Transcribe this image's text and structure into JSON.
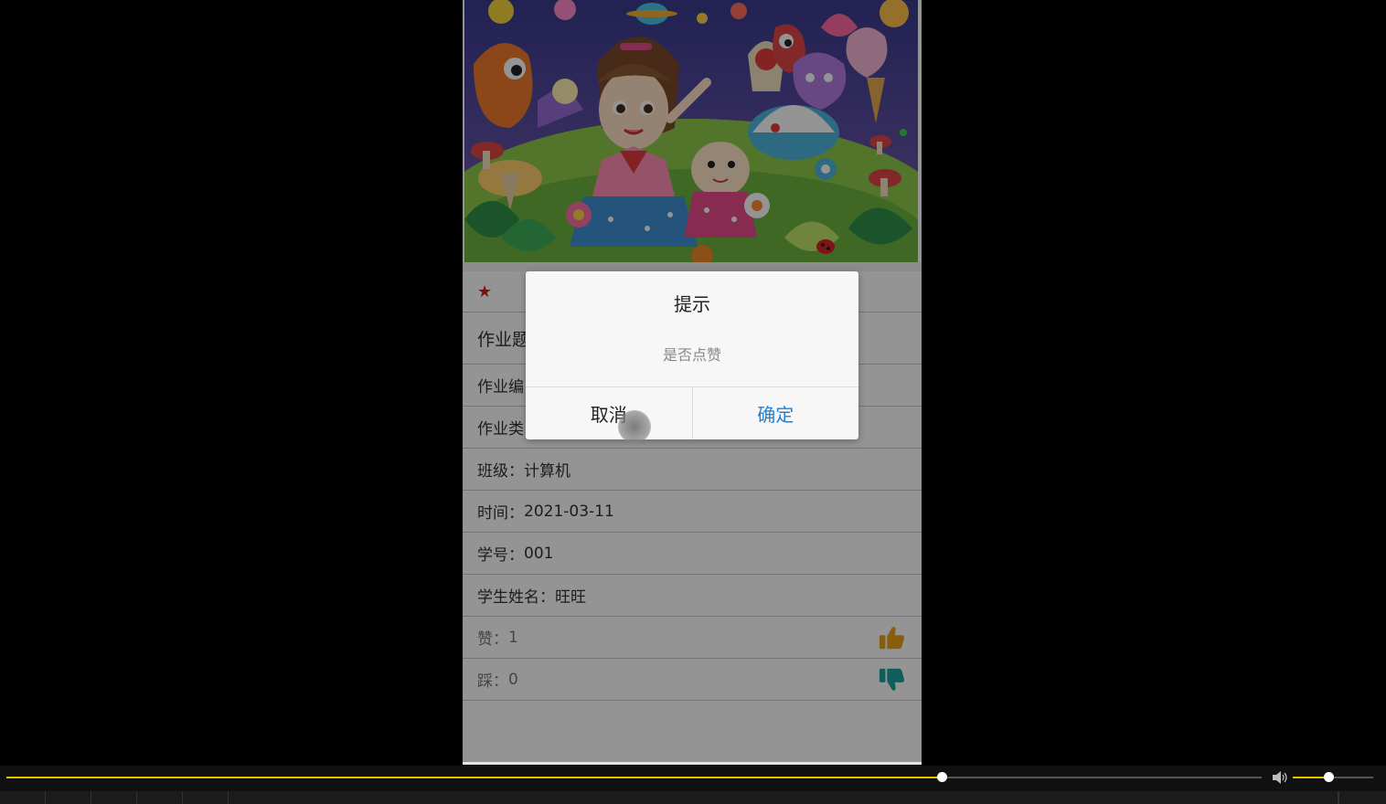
{
  "detail": {
    "title_label": "作业题",
    "code_label": "作业编",
    "type_label": "作业类",
    "class": {
      "label": "班级：",
      "value": "计算机"
    },
    "time": {
      "label": "时间：",
      "value": "2021-03-11"
    },
    "student_id": {
      "label": "学号：",
      "value": "001"
    },
    "student_name": {
      "label": "学生姓名：",
      "value": "旺旺"
    },
    "likes": {
      "label": "赞：",
      "value": "1",
      "icon": "thumbs-up-icon",
      "color": "#e8a317"
    },
    "dislikes": {
      "label": "踩：",
      "value": "0",
      "icon": "thumbs-down-icon",
      "color": "#1aa39a"
    },
    "star_icon": "star-icon",
    "star_glyph": "★",
    "star_color": "#d21f1f"
  },
  "dialog": {
    "title": "提示",
    "message": "是否点赞",
    "cancel_label": "取消",
    "confirm_label": "确定",
    "confirm_color": "#1e80d8"
  },
  "player": {
    "progress": 0.745,
    "volume": 0.44,
    "accent_color": "#e6c100",
    "volume_icon": "speaker-icon"
  }
}
